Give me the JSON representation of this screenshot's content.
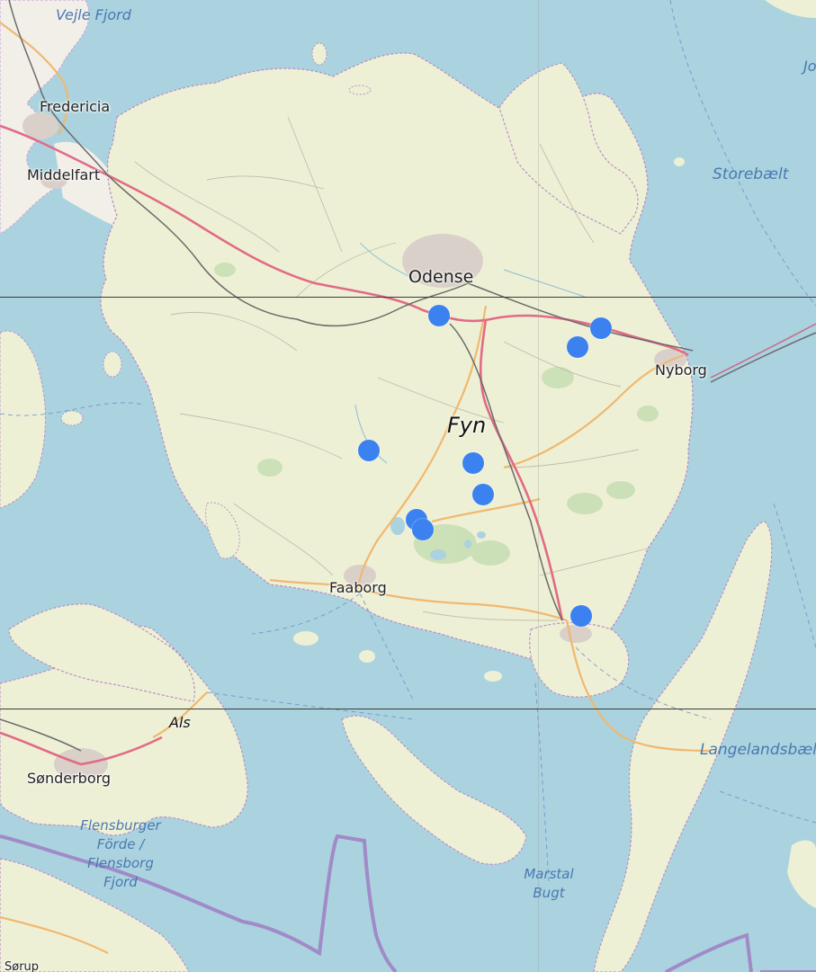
{
  "map": {
    "labels": {
      "vejle_fjord": "Vejle Fjord",
      "fredericia": "Fredericia",
      "middelfart": "Middelfart",
      "odense": "Odense",
      "nyborg": "Nyborg",
      "storebaelt": "Storebælt",
      "fyn": "Fyn",
      "faaborg": "Faaborg",
      "als": "Als",
      "sonderborg": "Sønderborg",
      "flensburger_l1": "Flensburger",
      "flensburger_l2": "Förde /",
      "flensburger_l3": "Flensborg",
      "flensburger_l4": "Fjord",
      "marstal_l1": "Marstal",
      "marstal_l2": "Bugt",
      "langelandsbaelt": "Langelandsbælt",
      "j_partial": "Jo",
      "sorup_partial": "Sørup"
    },
    "colors": {
      "water": "#aad3df",
      "land": "#f2efe9",
      "farmland": "#eef0d5",
      "forest": "#c8dfb4",
      "motorway": "#e892a2",
      "primary_road": "#fcd6a4",
      "railway": "#707070",
      "border": "#a584c6",
      "marker": "#3b82f0"
    }
  }
}
